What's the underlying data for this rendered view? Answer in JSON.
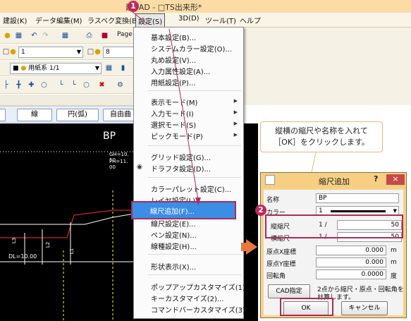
{
  "window": {
    "title": "建[     AD - □TS出来形*"
  },
  "menubar": {
    "items": [
      "建設(K)",
      "データ編集(M)",
      "ラスベク変換(B)",
      "設定(S)",
      "3D(D)",
      "ツール(T)",
      "ヘルプ"
    ]
  },
  "toolbar": {
    "page_label": "Page",
    "combo1_value": "1",
    "combo2_value": "8",
    "combo3_value": "用紙系 1/1"
  },
  "button_strip": {
    "btn1": "線",
    "btn2": "円(弧)",
    "btn3": "自由曲"
  },
  "canvas": {
    "label_bp": "BP",
    "text_gh": "GH=10. 50",
    "text_fh": "FH=11. 00",
    "label_l1": "L1",
    "label_l2": "L2",
    "label_l3": "L3",
    "text_dl": "DL=10.00"
  },
  "dropdown": {
    "items": [
      "基本設定(B)...",
      "システムカラー設定(O)...",
      "丸め設定(V)...",
      "入力属性設定(A)...",
      "用紙設定(P)...",
      "表示モード(M)",
      "入力モード(I)",
      "選択モード(S)",
      "ピックモード(P)",
      "グリッド設定(G)...",
      "ドラフタ設定(D)...",
      "カラーパレット設定(C)...",
      "レイヤ設定(L)...",
      "線尺追加(F)...",
      "線尺設定(E)...",
      "ペン設定(N)...",
      "線種設定(H)...",
      "形状表示(X)...",
      "ポップアップカスタマイズ(1)...",
      "キーカスタマイズ(2)...",
      "コマンドバーカスタマイズ(3)..."
    ]
  },
  "callouts": {
    "step1": "1",
    "step2": "2"
  },
  "bubble": {
    "line1": "縦横の縮尺や名称を入れて",
    "line2": "［OK］をクリックします。"
  },
  "dialog": {
    "title": "縮尺追加",
    "help": "?",
    "close": "×",
    "name_label": "名称",
    "name_value": "BP",
    "color_label": "カラー",
    "color_value": "1",
    "vscale_label": "縦縮尺",
    "vscale_prefix": "1 /",
    "vscale_value": "50",
    "hscale_label": "横縮尺",
    "hscale_prefix": "1 /",
    "hscale_value": "50",
    "ox_label": "原点X座標",
    "ox_value": "0.000",
    "ox_unit": "m",
    "oy_label": "原点Y座標",
    "oy_value": "0.000",
    "oy_unit": "m",
    "rot_label": "回転角",
    "rot_value": "0.0000",
    "rot_unit": "度",
    "cad_button": "CAD指定",
    "cad_desc_1": "2点から縮尺・原点・回転角を",
    "cad_desc_2": "計算します。",
    "ok_button": "OK",
    "cancel_button": "キャンセル"
  }
}
